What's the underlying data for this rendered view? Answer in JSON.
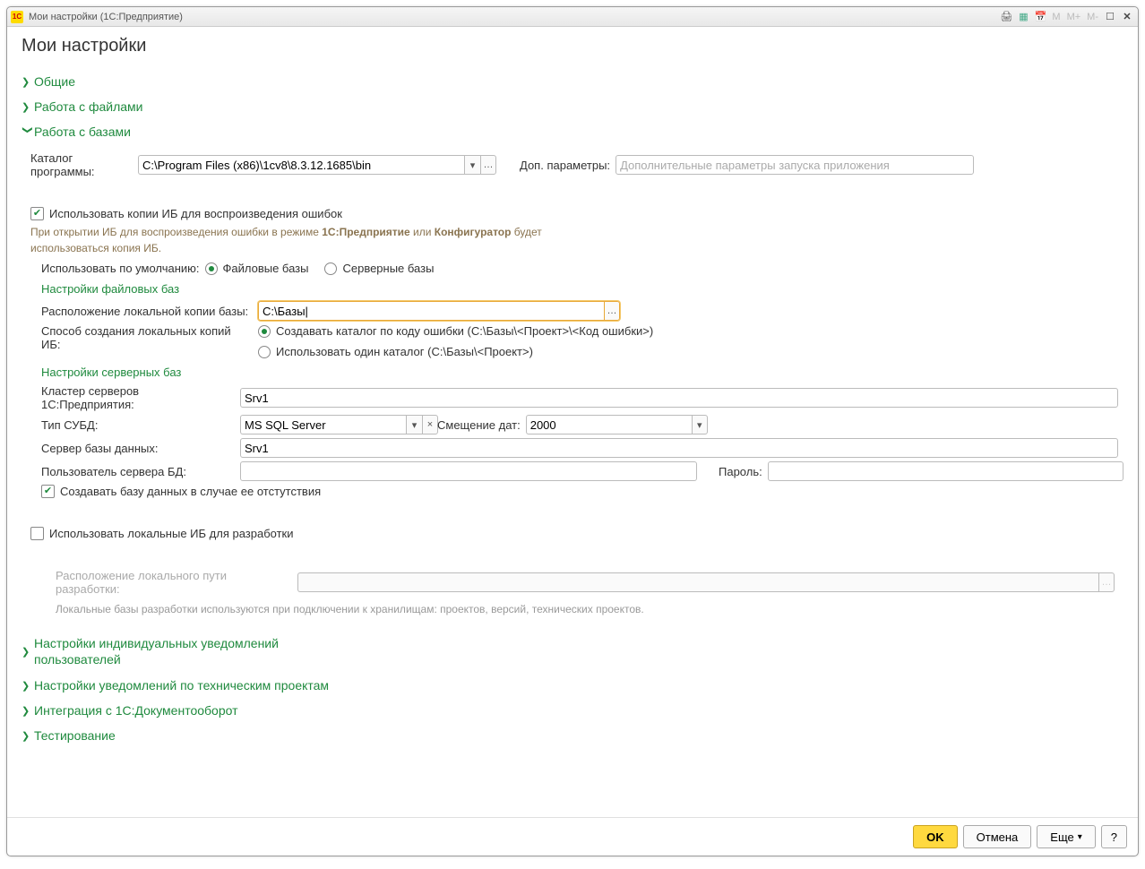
{
  "titlebar": {
    "app_badge": "1C",
    "title": "Мои настройки  (1С:Предприятие)",
    "m_labels": [
      "M",
      "M+",
      "M-"
    ]
  },
  "page_title": "Мои настройки",
  "sections": {
    "general": "Общие",
    "files": "Работа с файлами",
    "bases": "Работа с базами",
    "notif_users": "Настройки индивидуальных уведомлений пользователей",
    "notif_tech": "Настройки уведомлений по техническим проектам",
    "integration": "Интеграция с 1С:Документооборот",
    "testing": "Тестирование"
  },
  "bases": {
    "program_dir_label": "Каталог программы:",
    "program_dir_value": "C:\\Program Files (x86)\\1cv8\\8.3.12.1685\\bin",
    "extra_params_label": "Доп. параметры:",
    "extra_params_placeholder": "Дополнительные параметры запуска приложения",
    "use_copies_label": "Использовать копии ИБ для воспроизведения ошибок",
    "hint_line1": "При открытии ИБ для воспроизведения ошибки в режиме ",
    "hint_bold1": "1С:Предприятие",
    "hint_line2": " или ",
    "hint_bold2": "Конфигуратор",
    "hint_line3": " будет использоваться копия ИБ.",
    "default_label": "Использовать по умолчанию:",
    "radio_file": "Файловые базы",
    "radio_server": "Серверные базы",
    "file_settings_title": "Настройки файловых баз",
    "local_copy_label": "Расположение локальной копии базы:",
    "local_copy_value": "C:\\Базы|",
    "create_mode_label": "Способ создания локальных копий ИБ:",
    "radio_create_by_code": "Создавать каталог по коду ошибки (С:\\Базы\\<Проект>\\<Код ошибки>)",
    "radio_single_dir": "Использовать один каталог (С:\\Базы\\<Проект>)",
    "server_settings_title": "Настройки серверных баз",
    "cluster_label": "Кластер серверов 1С:Предприятия:",
    "cluster_value": "Srv1",
    "dbms_label": "Тип СУБД:",
    "dbms_value": "MS SQL Server",
    "date_offset_label": "Смещение дат:",
    "date_offset_value": "2000",
    "db_server_label": "Сервер базы данных:",
    "db_server_value": "Srv1",
    "db_user_label": "Пользователь сервера БД:",
    "db_pass_label": "Пароль:",
    "create_db_label": "Создавать базу данных в случае ее отстутствия",
    "use_local_dev_label": "Использовать локальные ИБ для разработки",
    "dev_path_label": "Расположение локального пути разработки:",
    "dev_hint": "Локальные базы разработки используются при подключении к хранилищам: проектов, версий, технических проектов."
  },
  "footer": {
    "ok": "OK",
    "cancel": "Отмена",
    "more": "Еще",
    "help": "?"
  }
}
